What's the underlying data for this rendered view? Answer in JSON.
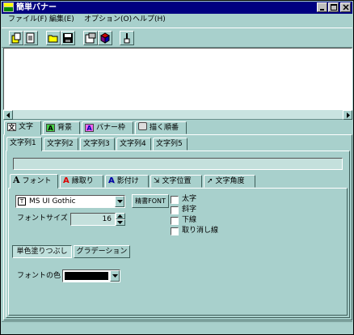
{
  "window": {
    "title": "簡単バナー"
  },
  "menu": [
    "ファイル(F)",
    "編集(E)",
    "オプション(O)",
    "ヘルプ(H)"
  ],
  "toolbar_icons": [
    "new-icon",
    "copy-icon",
    "open-folder-icon",
    "save-icon",
    "properties-icon",
    "book-icon",
    "brush-icon"
  ],
  "main_tabs": [
    "文字",
    "背景",
    "バナー枠",
    "描く順番"
  ],
  "string_tabs": [
    "文字列1",
    "文字列2",
    "文字列3",
    "文字列4",
    "文字列5"
  ],
  "text_input": {
    "value": ""
  },
  "font_tabs": [
    "フォント",
    "縁取り",
    "影付け",
    "文字位置",
    "文字角度"
  ],
  "font": {
    "name": "MS UI Gothic",
    "fixed_button": "精書FONT",
    "size_label": "フォントサイズ",
    "size_value": "16",
    "styles": [
      "太字",
      "斜字",
      "下線",
      "取り消し線"
    ]
  },
  "fill_modes": [
    "単色塗りつぶし",
    "グラデーション"
  ],
  "font_color": {
    "label": "フォントの色",
    "value": "#000000"
  }
}
